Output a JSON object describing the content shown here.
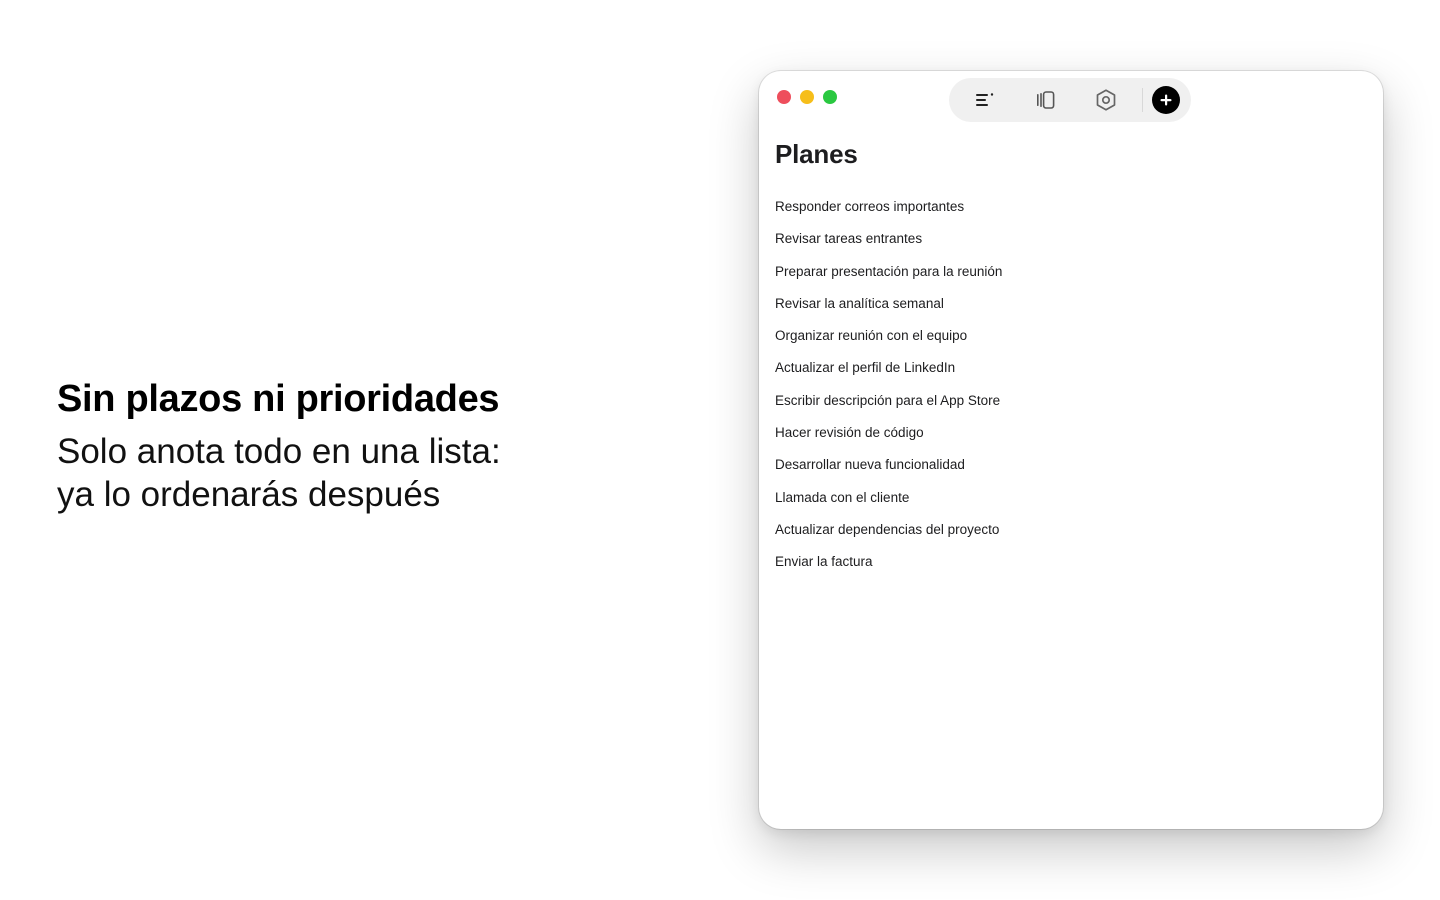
{
  "promo": {
    "title": "Sin plazos ni prioridades",
    "subtitle_line1": "Solo anota todo en una lista:",
    "subtitle_line2": "ya lo ordenarás después"
  },
  "window": {
    "traffic_lights": {
      "close_color": "#ee4e5c",
      "minimize_color": "#f6be1a",
      "zoom_color": "#2ac840"
    },
    "toolbar": {
      "icons": [
        "list-sort-icon",
        "cards-view-icon",
        "settings-hexagon-icon",
        "plus-icon"
      ],
      "bg_color": "#f0f0f0",
      "add_button_color": "#000000"
    },
    "list_title": "Planes",
    "tasks": [
      "Responder correos importantes",
      "Revisar tareas entrantes",
      "Preparar presentación para la reunión",
      "Revisar la analítica semanal",
      "Organizar reunión con el equipo",
      "Actualizar el perfil de LinkedIn",
      "Escribir descripción para el App Store",
      "Hacer revisión de código",
      "Desarrollar nueva funcionalidad",
      "Llamada con el cliente",
      "Actualizar dependencias del proyecto",
      "Enviar la factura"
    ]
  }
}
